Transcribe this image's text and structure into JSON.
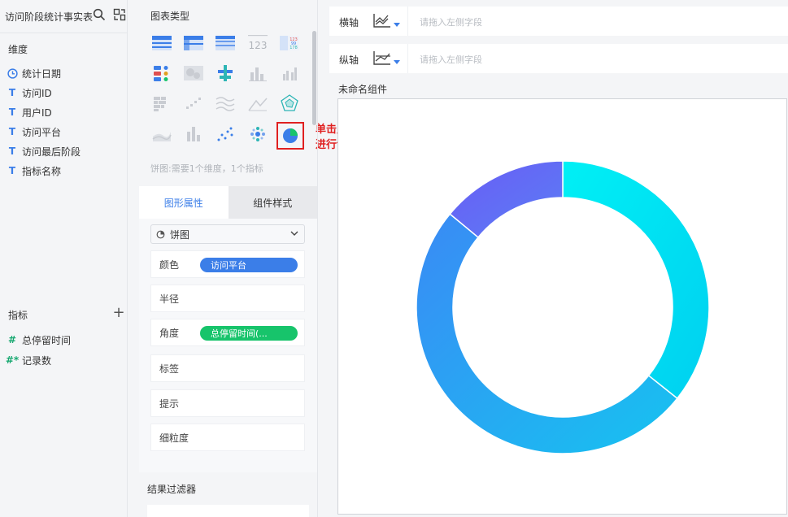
{
  "left_panel": {
    "title": "访问阶段统计事实表",
    "dimension_label": "维度",
    "dimensions": [
      {
        "label": "统计日期",
        "type_icon": "clock-icon",
        "glyph": "◷"
      },
      {
        "label": "访问ID",
        "type_icon": "text-type-icon",
        "glyph": "T"
      },
      {
        "label": "用户ID",
        "type_icon": "text-type-icon",
        "glyph": "T"
      },
      {
        "label": "访问平台",
        "type_icon": "text-type-icon",
        "glyph": "T"
      },
      {
        "label": "访问最后阶段",
        "type_icon": "text-type-icon",
        "glyph": "T"
      },
      {
        "label": "指标名称",
        "type_icon": "text-type-icon",
        "glyph": "T"
      }
    ],
    "measure_label": "指标",
    "add_symbol": "+",
    "measures": [
      {
        "label": "总停留时间",
        "glyph": "#"
      },
      {
        "label": "记录数",
        "glyph": "#*"
      }
    ]
  },
  "chart_panel": {
    "header": "图表类型",
    "chart_types": [
      "table-icon",
      "crosstable-icon",
      "detail-table-icon",
      "kpi-card-icon",
      "colored-table-icon",
      "dot-map-icon",
      "heatmap-icon",
      "stacked-bar-icon",
      "column-chart-icon",
      "grouped-column-icon",
      "rect-tree-icon",
      "scatter-icon",
      "multi-line-icon",
      "line-chart-icon",
      "radar-icon",
      "area-chart-icon",
      "grouped-bar-icon",
      "scatter-dots-icon",
      "bubble-icon",
      "pie-chart-icon"
    ],
    "kpi_text": "123",
    "selected_type": "pie-chart-icon",
    "hint": "饼图:需要1个维度，1个指标",
    "annotation": "单击此处的图表类型进行切换"
  },
  "tabs": [
    {
      "label": "图形属性",
      "active": true
    },
    {
      "label": "组件样式",
      "active": false
    }
  ],
  "properties": {
    "chart_select": "饼图",
    "rows": [
      {
        "label": "颜色",
        "pill": "访问平台",
        "pill_color": "#3b7ee8"
      },
      {
        "label": "半径",
        "pill": ""
      },
      {
        "label": "角度",
        "pill": "总停留时间(...",
        "pill_color": "#17c46b"
      },
      {
        "label": "标签",
        "pill": ""
      },
      {
        "label": "提示",
        "pill": ""
      },
      {
        "label": "细粒度",
        "pill": ""
      }
    ],
    "filter_title": "结果过滤器"
  },
  "axes": {
    "x_label": "横轴",
    "y_label": "纵轴",
    "placeholder": "请拖入左侧字段"
  },
  "component_title": "未命名组件",
  "chart_data": {
    "type": "pie",
    "title": "",
    "donut": true,
    "slices": [
      {
        "value": 35.7,
        "color_start": "#00f0f5",
        "color_end": "#00d0f0"
      },
      {
        "value": 50.3,
        "color_start": "#3a8af5",
        "color_end": "#16c3f0"
      },
      {
        "value": 14.0,
        "color_start": "#6a5cf5",
        "color_end": "#5a7ef5"
      }
    ]
  }
}
